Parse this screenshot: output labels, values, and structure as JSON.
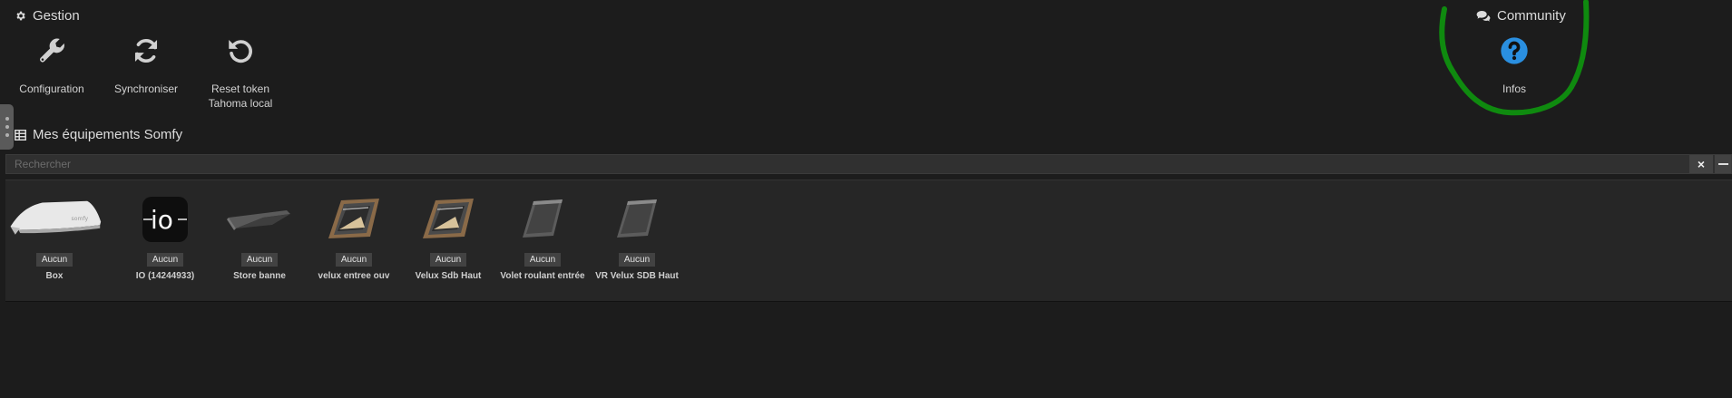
{
  "gestion": {
    "title": "Gestion",
    "icon": "gear-icon",
    "tiles": [
      {
        "label": "Configuration",
        "icon": "wrench-icon"
      },
      {
        "label": "Synchroniser",
        "icon": "sync-icon"
      },
      {
        "label": "Reset token\nTahoma local",
        "icon": "undo-icon"
      }
    ]
  },
  "community": {
    "title": "Community",
    "icon": "comments-icon",
    "tiles": [
      {
        "label": "Infos",
        "icon": "question-circle-icon"
      }
    ]
  },
  "equipements": {
    "title": "Mes équipements Somfy",
    "icon": "table-icon",
    "search": {
      "placeholder": "Rechercher",
      "value": ""
    },
    "clear_label": "×",
    "devices": [
      {
        "status": "Aucun",
        "name": "Box",
        "icon": "somfy-box-image"
      },
      {
        "status": "Aucun",
        "name": "IO (14244933)",
        "icon": "io-logo-image"
      },
      {
        "status": "Aucun",
        "name": "Store banne",
        "icon": "awning-image"
      },
      {
        "status": "Aucun",
        "name": "velux entree ouv",
        "icon": "roof-window-image"
      },
      {
        "status": "Aucun",
        "name": "Velux Sdb Haut",
        "icon": "roof-window-image"
      },
      {
        "status": "Aucun",
        "name": "Volet roulant entrée",
        "icon": "roller-shutter-image"
      },
      {
        "status": "Aucun",
        "name": "VR Velux SDB Haut",
        "icon": "roller-shutter-image"
      }
    ]
  },
  "colors": {
    "background": "#1c1c1c",
    "panel": "#262626",
    "info_blue": "#2a8fe0",
    "annotation_green": "#0f8a0f"
  }
}
